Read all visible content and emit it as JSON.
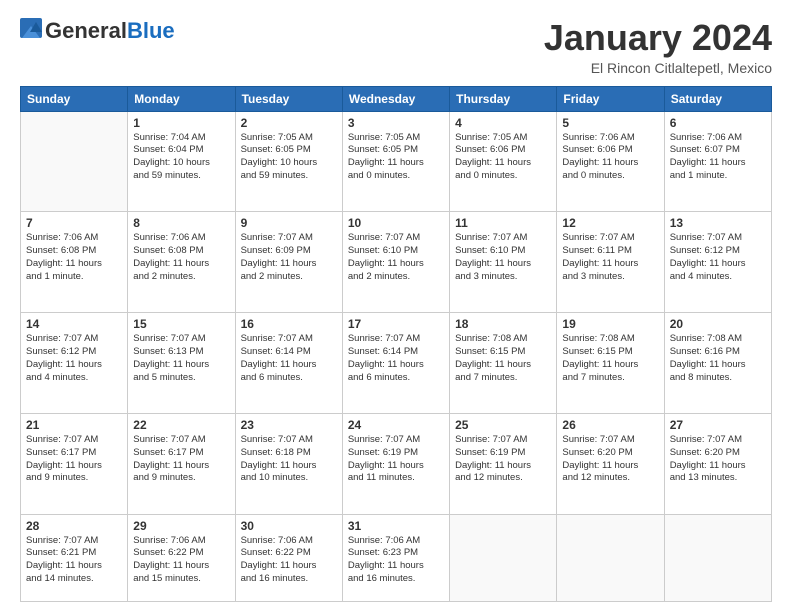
{
  "logo": {
    "general": "General",
    "blue": "Blue"
  },
  "title": "January 2024",
  "location": "El Rincon Citlaltepetl, Mexico",
  "weekdays": [
    "Sunday",
    "Monday",
    "Tuesday",
    "Wednesday",
    "Thursday",
    "Friday",
    "Saturday"
  ],
  "weeks": [
    [
      {
        "day": "",
        "info": ""
      },
      {
        "day": "1",
        "info": "Sunrise: 7:04 AM\nSunset: 6:04 PM\nDaylight: 10 hours\nand 59 minutes."
      },
      {
        "day": "2",
        "info": "Sunrise: 7:05 AM\nSunset: 6:05 PM\nDaylight: 10 hours\nand 59 minutes."
      },
      {
        "day": "3",
        "info": "Sunrise: 7:05 AM\nSunset: 6:05 PM\nDaylight: 11 hours\nand 0 minutes."
      },
      {
        "day": "4",
        "info": "Sunrise: 7:05 AM\nSunset: 6:06 PM\nDaylight: 11 hours\nand 0 minutes."
      },
      {
        "day": "5",
        "info": "Sunrise: 7:06 AM\nSunset: 6:06 PM\nDaylight: 11 hours\nand 0 minutes."
      },
      {
        "day": "6",
        "info": "Sunrise: 7:06 AM\nSunset: 6:07 PM\nDaylight: 11 hours\nand 1 minute."
      }
    ],
    [
      {
        "day": "7",
        "info": "Sunrise: 7:06 AM\nSunset: 6:08 PM\nDaylight: 11 hours\nand 1 minute."
      },
      {
        "day": "8",
        "info": "Sunrise: 7:06 AM\nSunset: 6:08 PM\nDaylight: 11 hours\nand 2 minutes."
      },
      {
        "day": "9",
        "info": "Sunrise: 7:07 AM\nSunset: 6:09 PM\nDaylight: 11 hours\nand 2 minutes."
      },
      {
        "day": "10",
        "info": "Sunrise: 7:07 AM\nSunset: 6:10 PM\nDaylight: 11 hours\nand 2 minutes."
      },
      {
        "day": "11",
        "info": "Sunrise: 7:07 AM\nSunset: 6:10 PM\nDaylight: 11 hours\nand 3 minutes."
      },
      {
        "day": "12",
        "info": "Sunrise: 7:07 AM\nSunset: 6:11 PM\nDaylight: 11 hours\nand 3 minutes."
      },
      {
        "day": "13",
        "info": "Sunrise: 7:07 AM\nSunset: 6:12 PM\nDaylight: 11 hours\nand 4 minutes."
      }
    ],
    [
      {
        "day": "14",
        "info": "Sunrise: 7:07 AM\nSunset: 6:12 PM\nDaylight: 11 hours\nand 4 minutes."
      },
      {
        "day": "15",
        "info": "Sunrise: 7:07 AM\nSunset: 6:13 PM\nDaylight: 11 hours\nand 5 minutes."
      },
      {
        "day": "16",
        "info": "Sunrise: 7:07 AM\nSunset: 6:14 PM\nDaylight: 11 hours\nand 6 minutes."
      },
      {
        "day": "17",
        "info": "Sunrise: 7:07 AM\nSunset: 6:14 PM\nDaylight: 11 hours\nand 6 minutes."
      },
      {
        "day": "18",
        "info": "Sunrise: 7:08 AM\nSunset: 6:15 PM\nDaylight: 11 hours\nand 7 minutes."
      },
      {
        "day": "19",
        "info": "Sunrise: 7:08 AM\nSunset: 6:15 PM\nDaylight: 11 hours\nand 7 minutes."
      },
      {
        "day": "20",
        "info": "Sunrise: 7:08 AM\nSunset: 6:16 PM\nDaylight: 11 hours\nand 8 minutes."
      }
    ],
    [
      {
        "day": "21",
        "info": "Sunrise: 7:07 AM\nSunset: 6:17 PM\nDaylight: 11 hours\nand 9 minutes."
      },
      {
        "day": "22",
        "info": "Sunrise: 7:07 AM\nSunset: 6:17 PM\nDaylight: 11 hours\nand 9 minutes."
      },
      {
        "day": "23",
        "info": "Sunrise: 7:07 AM\nSunset: 6:18 PM\nDaylight: 11 hours\nand 10 minutes."
      },
      {
        "day": "24",
        "info": "Sunrise: 7:07 AM\nSunset: 6:19 PM\nDaylight: 11 hours\nand 11 minutes."
      },
      {
        "day": "25",
        "info": "Sunrise: 7:07 AM\nSunset: 6:19 PM\nDaylight: 11 hours\nand 12 minutes."
      },
      {
        "day": "26",
        "info": "Sunrise: 7:07 AM\nSunset: 6:20 PM\nDaylight: 11 hours\nand 12 minutes."
      },
      {
        "day": "27",
        "info": "Sunrise: 7:07 AM\nSunset: 6:20 PM\nDaylight: 11 hours\nand 13 minutes."
      }
    ],
    [
      {
        "day": "28",
        "info": "Sunrise: 7:07 AM\nSunset: 6:21 PM\nDaylight: 11 hours\nand 14 minutes."
      },
      {
        "day": "29",
        "info": "Sunrise: 7:06 AM\nSunset: 6:22 PM\nDaylight: 11 hours\nand 15 minutes."
      },
      {
        "day": "30",
        "info": "Sunrise: 7:06 AM\nSunset: 6:22 PM\nDaylight: 11 hours\nand 16 minutes."
      },
      {
        "day": "31",
        "info": "Sunrise: 7:06 AM\nSunset: 6:23 PM\nDaylight: 11 hours\nand 16 minutes."
      },
      {
        "day": "",
        "info": ""
      },
      {
        "day": "",
        "info": ""
      },
      {
        "day": "",
        "info": ""
      }
    ]
  ]
}
